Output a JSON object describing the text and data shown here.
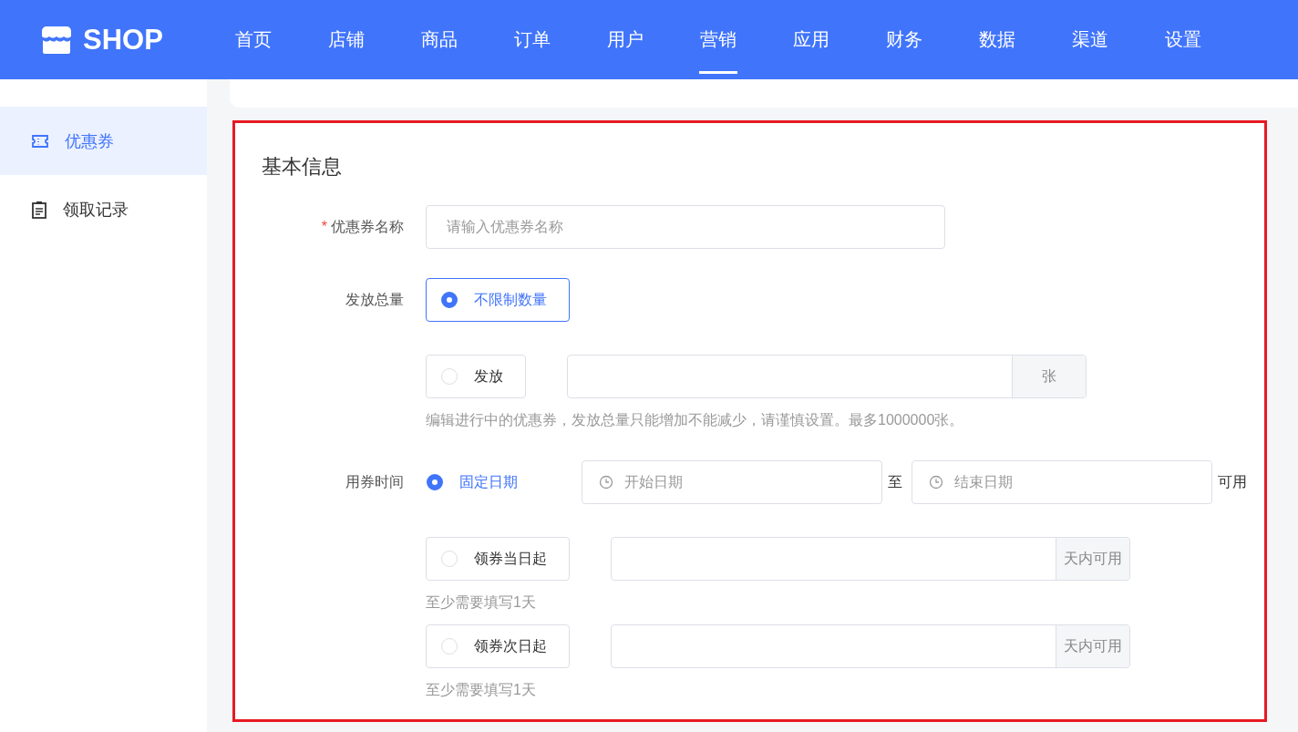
{
  "header": {
    "logo": "SHOP",
    "nav": [
      {
        "label": "首页",
        "selected": false
      },
      {
        "label": "店铺",
        "selected": false
      },
      {
        "label": "商品",
        "selected": false
      },
      {
        "label": "订单",
        "selected": false
      },
      {
        "label": "用户",
        "selected": false
      },
      {
        "label": "营销",
        "selected": true
      },
      {
        "label": "应用",
        "selected": false
      },
      {
        "label": "财务",
        "selected": false
      },
      {
        "label": "数据",
        "selected": false
      },
      {
        "label": "渠道",
        "selected": false
      },
      {
        "label": "设置",
        "selected": false
      }
    ]
  },
  "sidebar": {
    "items": [
      {
        "kind": "ticket",
        "label": "优惠券",
        "selected": true
      },
      {
        "kind": "clipboard",
        "label": "领取记录",
        "selected": false
      }
    ]
  },
  "form": {
    "title": "基本信息",
    "fields": [
      {
        "kind": "text",
        "label": "优惠券名称",
        "required_mark": "*",
        "placeholder": "请输入优惠券名称"
      },
      {
        "kind": "choice",
        "label": "发放总量",
        "options": [
          {
            "kind": "plain",
            "label": "不限制数量",
            "selected": true
          },
          {
            "kind": "amount",
            "label": "发放",
            "selected": false,
            "unit": "张",
            "hint": "编辑进行中的优惠券，发放总量只能增加不能减少，请谨慎设置。最多1000000张。"
          }
        ]
      },
      {
        "kind": "choice",
        "label": "用券时间",
        "options": [
          {
            "kind": "range",
            "label": "固定日期",
            "selected": true,
            "start_placeholder": "开始日期",
            "separator": "至",
            "end_placeholder": "结束日期",
            "suffix": "可用"
          },
          {
            "kind": "amount",
            "label": "领券当日起",
            "selected": false,
            "unit": "天内可用",
            "hint": "至少需要填写1天"
          },
          {
            "kind": "amount",
            "label": "领券次日起",
            "selected": false,
            "unit": "天内可用",
            "hint": "至少需要填写1天"
          }
        ]
      }
    ]
  }
}
